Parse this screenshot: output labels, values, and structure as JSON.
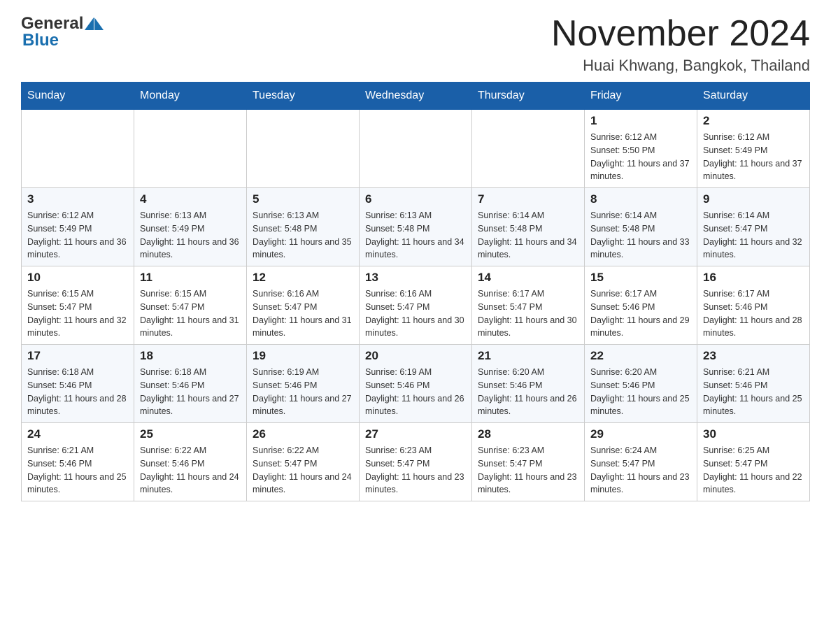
{
  "header": {
    "logo_general": "General",
    "logo_blue": "Blue",
    "month_title": "November 2024",
    "location": "Huai Khwang, Bangkok, Thailand"
  },
  "weekdays": [
    "Sunday",
    "Monday",
    "Tuesday",
    "Wednesday",
    "Thursday",
    "Friday",
    "Saturday"
  ],
  "weeks": [
    [
      {
        "day": "",
        "sunrise": "",
        "sunset": "",
        "daylight": ""
      },
      {
        "day": "",
        "sunrise": "",
        "sunset": "",
        "daylight": ""
      },
      {
        "day": "",
        "sunrise": "",
        "sunset": "",
        "daylight": ""
      },
      {
        "day": "",
        "sunrise": "",
        "sunset": "",
        "daylight": ""
      },
      {
        "day": "",
        "sunrise": "",
        "sunset": "",
        "daylight": ""
      },
      {
        "day": "1",
        "sunrise": "Sunrise: 6:12 AM",
        "sunset": "Sunset: 5:50 PM",
        "daylight": "Daylight: 11 hours and 37 minutes."
      },
      {
        "day": "2",
        "sunrise": "Sunrise: 6:12 AM",
        "sunset": "Sunset: 5:49 PM",
        "daylight": "Daylight: 11 hours and 37 minutes."
      }
    ],
    [
      {
        "day": "3",
        "sunrise": "Sunrise: 6:12 AM",
        "sunset": "Sunset: 5:49 PM",
        "daylight": "Daylight: 11 hours and 36 minutes."
      },
      {
        "day": "4",
        "sunrise": "Sunrise: 6:13 AM",
        "sunset": "Sunset: 5:49 PM",
        "daylight": "Daylight: 11 hours and 36 minutes."
      },
      {
        "day": "5",
        "sunrise": "Sunrise: 6:13 AM",
        "sunset": "Sunset: 5:48 PM",
        "daylight": "Daylight: 11 hours and 35 minutes."
      },
      {
        "day": "6",
        "sunrise": "Sunrise: 6:13 AM",
        "sunset": "Sunset: 5:48 PM",
        "daylight": "Daylight: 11 hours and 34 minutes."
      },
      {
        "day": "7",
        "sunrise": "Sunrise: 6:14 AM",
        "sunset": "Sunset: 5:48 PM",
        "daylight": "Daylight: 11 hours and 34 minutes."
      },
      {
        "day": "8",
        "sunrise": "Sunrise: 6:14 AM",
        "sunset": "Sunset: 5:48 PM",
        "daylight": "Daylight: 11 hours and 33 minutes."
      },
      {
        "day": "9",
        "sunrise": "Sunrise: 6:14 AM",
        "sunset": "Sunset: 5:47 PM",
        "daylight": "Daylight: 11 hours and 32 minutes."
      }
    ],
    [
      {
        "day": "10",
        "sunrise": "Sunrise: 6:15 AM",
        "sunset": "Sunset: 5:47 PM",
        "daylight": "Daylight: 11 hours and 32 minutes."
      },
      {
        "day": "11",
        "sunrise": "Sunrise: 6:15 AM",
        "sunset": "Sunset: 5:47 PM",
        "daylight": "Daylight: 11 hours and 31 minutes."
      },
      {
        "day": "12",
        "sunrise": "Sunrise: 6:16 AM",
        "sunset": "Sunset: 5:47 PM",
        "daylight": "Daylight: 11 hours and 31 minutes."
      },
      {
        "day": "13",
        "sunrise": "Sunrise: 6:16 AM",
        "sunset": "Sunset: 5:47 PM",
        "daylight": "Daylight: 11 hours and 30 minutes."
      },
      {
        "day": "14",
        "sunrise": "Sunrise: 6:17 AM",
        "sunset": "Sunset: 5:47 PM",
        "daylight": "Daylight: 11 hours and 30 minutes."
      },
      {
        "day": "15",
        "sunrise": "Sunrise: 6:17 AM",
        "sunset": "Sunset: 5:46 PM",
        "daylight": "Daylight: 11 hours and 29 minutes."
      },
      {
        "day": "16",
        "sunrise": "Sunrise: 6:17 AM",
        "sunset": "Sunset: 5:46 PM",
        "daylight": "Daylight: 11 hours and 28 minutes."
      }
    ],
    [
      {
        "day": "17",
        "sunrise": "Sunrise: 6:18 AM",
        "sunset": "Sunset: 5:46 PM",
        "daylight": "Daylight: 11 hours and 28 minutes."
      },
      {
        "day": "18",
        "sunrise": "Sunrise: 6:18 AM",
        "sunset": "Sunset: 5:46 PM",
        "daylight": "Daylight: 11 hours and 27 minutes."
      },
      {
        "day": "19",
        "sunrise": "Sunrise: 6:19 AM",
        "sunset": "Sunset: 5:46 PM",
        "daylight": "Daylight: 11 hours and 27 minutes."
      },
      {
        "day": "20",
        "sunrise": "Sunrise: 6:19 AM",
        "sunset": "Sunset: 5:46 PM",
        "daylight": "Daylight: 11 hours and 26 minutes."
      },
      {
        "day": "21",
        "sunrise": "Sunrise: 6:20 AM",
        "sunset": "Sunset: 5:46 PM",
        "daylight": "Daylight: 11 hours and 26 minutes."
      },
      {
        "day": "22",
        "sunrise": "Sunrise: 6:20 AM",
        "sunset": "Sunset: 5:46 PM",
        "daylight": "Daylight: 11 hours and 25 minutes."
      },
      {
        "day": "23",
        "sunrise": "Sunrise: 6:21 AM",
        "sunset": "Sunset: 5:46 PM",
        "daylight": "Daylight: 11 hours and 25 minutes."
      }
    ],
    [
      {
        "day": "24",
        "sunrise": "Sunrise: 6:21 AM",
        "sunset": "Sunset: 5:46 PM",
        "daylight": "Daylight: 11 hours and 25 minutes."
      },
      {
        "day": "25",
        "sunrise": "Sunrise: 6:22 AM",
        "sunset": "Sunset: 5:46 PM",
        "daylight": "Daylight: 11 hours and 24 minutes."
      },
      {
        "day": "26",
        "sunrise": "Sunrise: 6:22 AM",
        "sunset": "Sunset: 5:47 PM",
        "daylight": "Daylight: 11 hours and 24 minutes."
      },
      {
        "day": "27",
        "sunrise": "Sunrise: 6:23 AM",
        "sunset": "Sunset: 5:47 PM",
        "daylight": "Daylight: 11 hours and 23 minutes."
      },
      {
        "day": "28",
        "sunrise": "Sunrise: 6:23 AM",
        "sunset": "Sunset: 5:47 PM",
        "daylight": "Daylight: 11 hours and 23 minutes."
      },
      {
        "day": "29",
        "sunrise": "Sunrise: 6:24 AM",
        "sunset": "Sunset: 5:47 PM",
        "daylight": "Daylight: 11 hours and 23 minutes."
      },
      {
        "day": "30",
        "sunrise": "Sunrise: 6:25 AM",
        "sunset": "Sunset: 5:47 PM",
        "daylight": "Daylight: 11 hours and 22 minutes."
      }
    ]
  ]
}
